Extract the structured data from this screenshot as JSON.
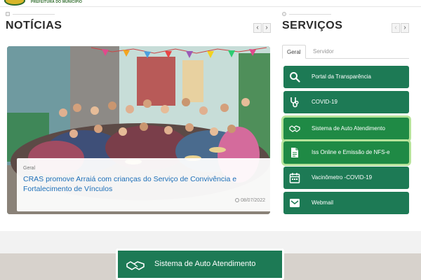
{
  "header": {
    "brand_text": "PREFEITURA DO MUNICÍPIO"
  },
  "news": {
    "title": "NOTÍCIAS",
    "prev_label": "‹",
    "next_label": "›",
    "item": {
      "category": "Geral",
      "headline": "CRAS promove Arraiá com crianças do Serviço de Convivência e Fortalecimento de Vínculos",
      "date": "08/07/2022"
    }
  },
  "services": {
    "title": "SERVIÇOS",
    "prev_label": "‹",
    "next_label": "›",
    "tabs": [
      "Geral",
      "Servidor"
    ],
    "items": [
      {
        "label": "Portal da Transparência",
        "icon": "search-icon"
      },
      {
        "label": "COVID-19",
        "icon": "stethoscope-icon"
      },
      {
        "label": "Sistema de Auto Atendimento",
        "icon": "handshake-icon"
      },
      {
        "label": "Iss Online e Emissão de NFS-e",
        "icon": "document-icon"
      },
      {
        "label": "Vacinômetro -COVID-19",
        "icon": "calendar-icon"
      },
      {
        "label": "Webmail",
        "icon": "envelope-icon"
      }
    ]
  },
  "bottom_banner": {
    "label": "Sistema de Auto Atendimento",
    "icon": "handshake-icon"
  },
  "colors": {
    "service_green": "#1d7a55",
    "highlight_green": "#1f8a45",
    "link_blue": "#1d6fb8"
  }
}
